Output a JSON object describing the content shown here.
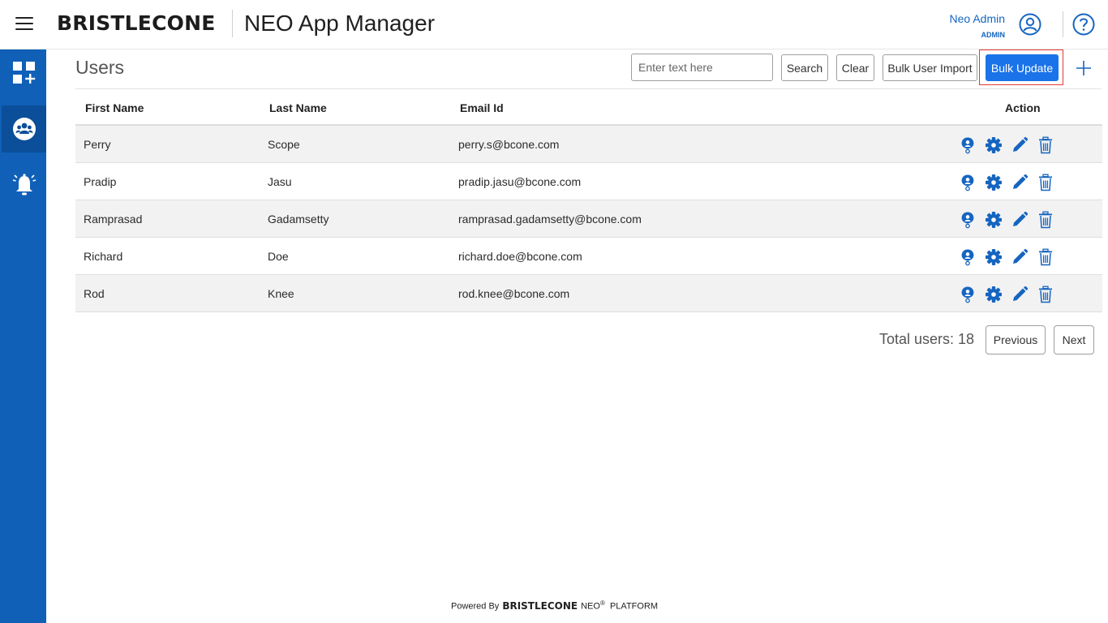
{
  "header": {
    "brand": "BRISTLECONE",
    "app_title": "NEO App Manager",
    "user_name": "Neo Admin",
    "user_role": "ADMIN"
  },
  "sidebar": {
    "items": [
      {
        "icon": "dashboard-add-icon"
      },
      {
        "icon": "users-group-icon",
        "active": true
      },
      {
        "icon": "notification-bell-icon"
      }
    ]
  },
  "page": {
    "title": "Users"
  },
  "toolbar": {
    "search_placeholder": "Enter text here",
    "search_label": "Search",
    "clear_label": "Clear",
    "bulk_import_label": "Bulk User Import",
    "bulk_update_label": "Bulk Update"
  },
  "table": {
    "columns": [
      "First Name",
      "Last Name",
      "Email Id",
      "Action"
    ],
    "rows": [
      {
        "first": "Perry",
        "last": "Scope",
        "email": "perry.s@bcone.com"
      },
      {
        "first": "Pradip",
        "last": "Jasu",
        "email": "pradip.jasu@bcone.com"
      },
      {
        "first": "Ramprasad",
        "last": "Gadamsetty",
        "email": "ramprasad.gadamsetty@bcone.com"
      },
      {
        "first": "Richard",
        "last": "Doe",
        "email": "richard.doe@bcone.com"
      },
      {
        "first": "Rod",
        "last": "Knee",
        "email": "rod.knee@bcone.com"
      }
    ],
    "action_icons": [
      "user-badge-icon",
      "gear-icon",
      "pencil-icon",
      "trash-icon"
    ]
  },
  "pagination": {
    "total_text": "Total users: 18",
    "previous_label": "Previous",
    "next_label": "Next"
  },
  "footer": {
    "powered_by": "Powered By",
    "brand": "BRISTLECONE",
    "product": "NEO",
    "registered": "®",
    "platform": "PLATFORM"
  },
  "colors": {
    "sidebar": "#1060b8",
    "sidebar_active": "#0b4e99",
    "accent": "#1a73e8",
    "icon_blue": "#1565c0",
    "highlight": "#e53935"
  }
}
